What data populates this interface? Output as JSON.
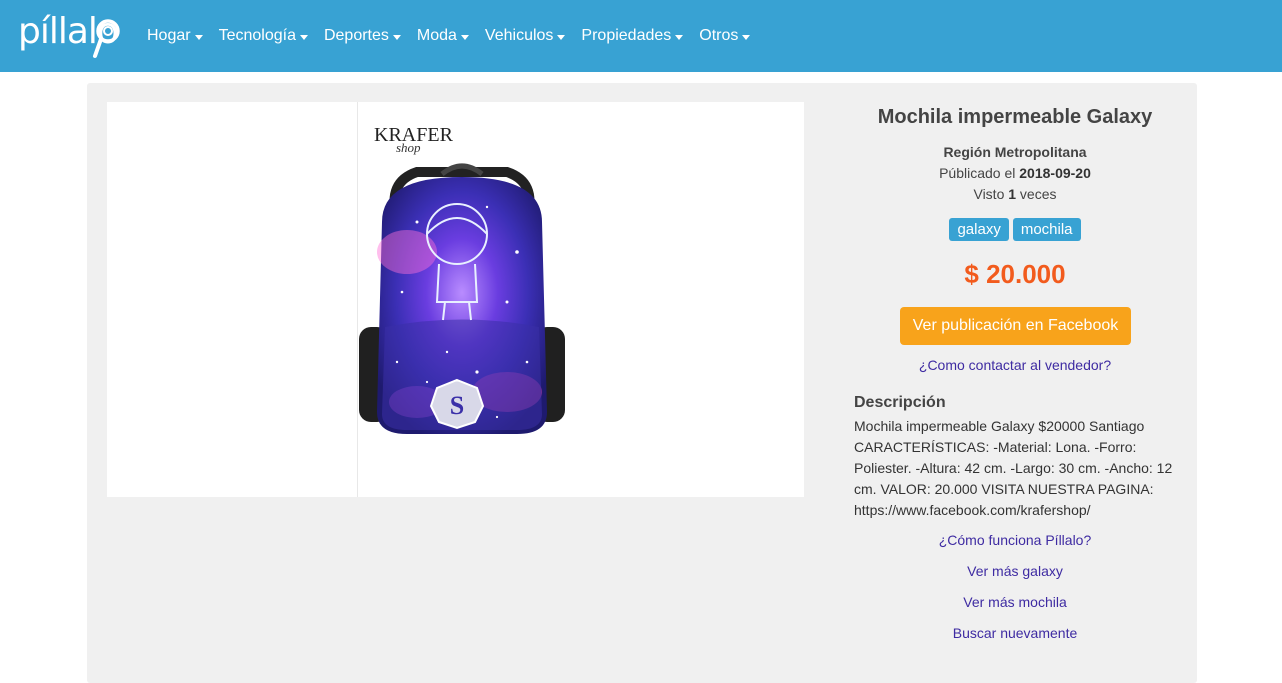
{
  "brand": {
    "logo_text": "píllalo"
  },
  "nav": {
    "items": [
      {
        "label": "Hogar"
      },
      {
        "label": "Tecnología"
      },
      {
        "label": "Deportes"
      },
      {
        "label": "Moda"
      },
      {
        "label": "Vehiculos"
      },
      {
        "label": "Propiedades"
      },
      {
        "label": "Otros"
      }
    ]
  },
  "product": {
    "image_brand": "KRAFER",
    "image_brand_sub": "shop",
    "title": "Mochila impermeable Galaxy",
    "region": "Región Metropolitana",
    "published_prefix": "Públicado el ",
    "published_date": "2018-09-20",
    "views_prefix": "Visto ",
    "views_count": "1",
    "views_suffix": " veces",
    "tags": [
      "galaxy",
      "mochila"
    ],
    "price": "$ 20.000",
    "fb_button": "Ver publicación en Facebook",
    "contact_link": "¿Como contactar al vendedor?",
    "description_title": "Descripción",
    "description": "Mochila impermeable Galaxy $20000 Santiago CARACTERÍSTICAS: -Material: Lona. -Forro: Poliester. -Altura: 42 cm. -Largo: 30 cm. -Ancho: 12 cm. VALOR: 20.000 VISITA NUESTRA PAGINA: https://www.facebook.com/krafershop/",
    "links": {
      "how_it_works": "¿Cómo funciona Píllalo?",
      "more_tag1": "Ver más galaxy",
      "more_tag2": "Ver más mochila",
      "search_again": "Buscar nuevamente"
    }
  },
  "colors": {
    "navbar": "#38a2d3",
    "price": "#f25b1d",
    "fb_button": "#f8a31b",
    "link": "#3e2ba2",
    "card_bg": "#f0f0f0"
  }
}
